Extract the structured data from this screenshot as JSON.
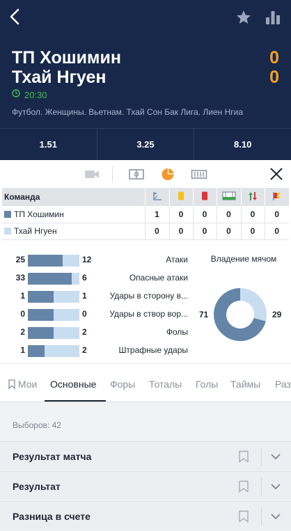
{
  "match": {
    "team1": "ТП Хошимин",
    "team2": "Тхай Нгуен",
    "score1": "0",
    "score2": "0",
    "time": "20:30",
    "league": "Футбол. Женщины. Вьетнам. Тхай Сон Бак Лига. Лиен Нгиа"
  },
  "odds": [
    "1.51",
    "3.25",
    "8.10"
  ],
  "events_table": {
    "header": "Команда",
    "icons": [
      "corner-icon",
      "yellow-card-icon",
      "red-card-icon",
      "penalty-icon",
      "substitution-icon",
      "offside-icon"
    ],
    "rows": [
      {
        "team": "ТП Хошимин",
        "values": [
          "1",
          "0",
          "0",
          "0",
          "0",
          "0"
        ]
      },
      {
        "team": "Тхай Нгуен",
        "values": [
          "0",
          "0",
          "0",
          "0",
          "0",
          "0"
        ]
      }
    ]
  },
  "stats": [
    {
      "left": "25",
      "right": "12",
      "label": "Атаки",
      "share": 0.68
    },
    {
      "left": "33",
      "right": "6",
      "label": "Опасные атаки",
      "share": 0.85
    },
    {
      "left": "1",
      "right": "1",
      "label": "Удары в сторону в...",
      "share": 0.5
    },
    {
      "left": "0",
      "right": "0",
      "label": "Удары в створ вор...",
      "share": 0.5
    },
    {
      "left": "2",
      "right": "2",
      "label": "Фолы",
      "share": 0.5
    },
    {
      "left": "1",
      "right": "2",
      "label": "Штрафные удары",
      "share": 0.33
    }
  ],
  "possession": {
    "title": "Владение мячом",
    "team1": 71,
    "team2": 29
  },
  "tabs": [
    "Мои",
    "Основные",
    "Форы",
    "Тоталы",
    "Голы",
    "Таймы",
    "Раз"
  ],
  "active_tab": "Основные",
  "selections_label": "Выборов: 42",
  "markets": [
    "Результат матча",
    "Результат",
    "Разница в счете"
  ],
  "colors": {
    "header_bg": "#17284a",
    "score": "#f7a023",
    "time": "#41c24e",
    "team1": "#6585a8",
    "team2": "#c9ddf1",
    "accent_orange": "#f19a2b"
  }
}
